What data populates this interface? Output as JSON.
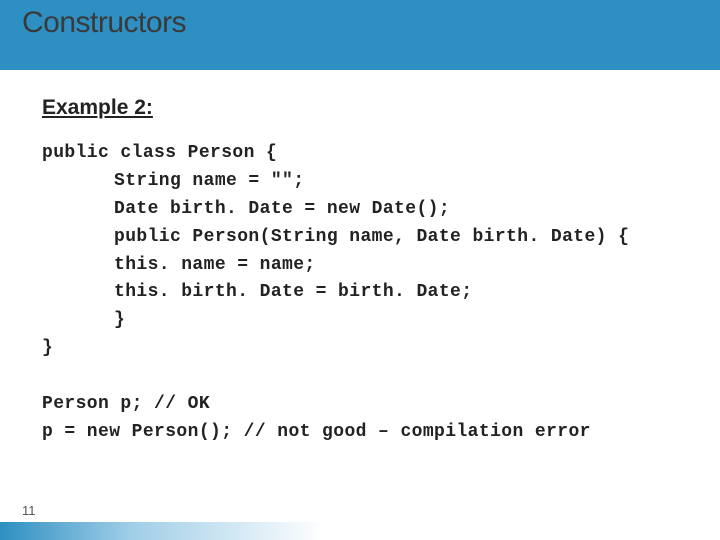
{
  "title": "Constructors",
  "heading": "Example 2:",
  "code": {
    "l0": "public class Person {",
    "l1_indent": "    ",
    "l1": "String name = \"\";",
    "l2": "Date birth. Date = new Date();",
    "l3": "public Person(String name, Date birth. Date) {",
    "l4": "this. name = name;",
    "l5": "this. birth. Date = birth. Date;",
    "l6": "}",
    "l7": "}",
    "blank": "",
    "l8": "Person p; // OK",
    "l9": "p = new Person(); // not good – compilation error"
  },
  "pageNumber": "11"
}
